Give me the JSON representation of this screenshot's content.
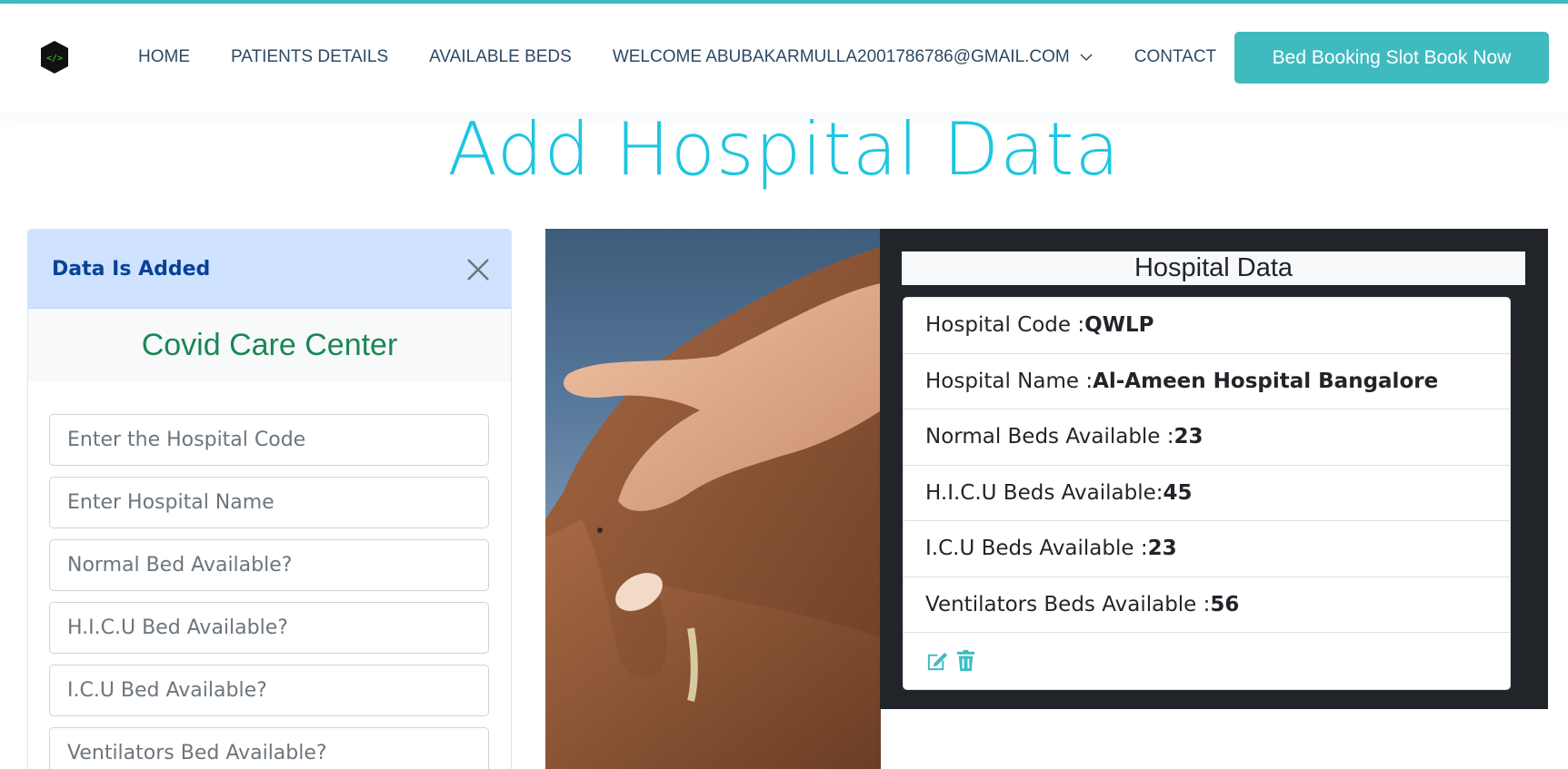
{
  "header": {
    "nav": {
      "home": "HOME",
      "patients_details": "PATIENTS DETAILS",
      "available_beds": "AVAILABLE BEDS",
      "welcome": "WELCOME ABUBAKARMULLA2001786786@GMAIL.COM",
      "contact": "CONTACT"
    },
    "book_button": "Bed Booking Slot Book Now"
  },
  "page_title": "Add Hospital Data",
  "alert": {
    "text": "Data Is Added"
  },
  "form": {
    "title": "Covid Care Center",
    "fields": {
      "hospital_code": {
        "placeholder": "Enter the Hospital Code",
        "value": ""
      },
      "hospital_name": {
        "placeholder": "Enter Hospital Name",
        "value": ""
      },
      "normal_bed": {
        "placeholder": "Normal Bed Available?",
        "value": ""
      },
      "hicu_bed": {
        "placeholder": "H.I.C.U Bed Available?",
        "value": ""
      },
      "icu_bed": {
        "placeholder": "I.C.U Bed Available?",
        "value": ""
      },
      "ventilator_bed": {
        "placeholder": "Ventilators Bed Available?",
        "value": ""
      }
    }
  },
  "hospital_data": {
    "title": "Hospital Data",
    "rows": [
      {
        "label": "Hospital Code : ",
        "value": "QWLP"
      },
      {
        "label": "Hospital Name : ",
        "value": "Al-Ameen Hospital Bangalore"
      },
      {
        "label": "Normal Beds Available :",
        "value": "23"
      },
      {
        "label": "H.I.C.U Beds Available: ",
        "value": "45"
      },
      {
        "label": "I.C.U Beds Available :",
        "value": "23"
      },
      {
        "label": "Ventilators Beds Available : ",
        "value": "56"
      }
    ]
  },
  "icons": {
    "logo": "code-cube-logo",
    "dropdown": "chevron-down-icon",
    "close": "close-icon",
    "edit": "edit-icon",
    "delete": "trash-icon"
  },
  "colors": {
    "accent": "#3fbbc0",
    "title": "#1ec6e0",
    "success": "#198754",
    "alert_bg": "#cfe2ff",
    "alert_text": "#084298",
    "dark_panel": "#212529"
  }
}
